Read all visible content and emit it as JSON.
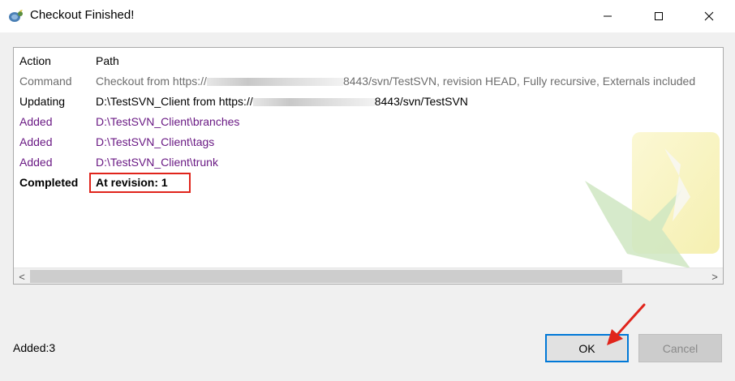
{
  "window": {
    "title": "Checkout Finished!",
    "controls": {
      "minimize": "minimize",
      "maximize": "maximize",
      "close": "close"
    }
  },
  "table": {
    "headers": {
      "action": "Action",
      "path": "Path"
    },
    "rows": [
      {
        "action": "Command",
        "path_prefix": "Checkout from https://",
        "path_suffix": "8443/svn/TestSVN, revision HEAD, Fully recursive, Externals included"
      },
      {
        "action": "Updating",
        "path_prefix": "D:\\TestSVN_Client from https://",
        "path_suffix": "8443/svn/TestSVN"
      },
      {
        "action": "Added",
        "path": "D:\\TestSVN_Client\\branches"
      },
      {
        "action": "Added",
        "path": "D:\\TestSVN_Client\\tags"
      },
      {
        "action": "Added",
        "path": "D:\\TestSVN_Client\\trunk"
      },
      {
        "action": "Completed",
        "path": "At revision: 1"
      }
    ]
  },
  "scrollbar": {
    "left": "<",
    "right": ">"
  },
  "status": "Added:3",
  "buttons": {
    "ok": "OK",
    "cancel": "Cancel"
  },
  "colors": {
    "command_text": "#6d6d6d",
    "added_text": "#6a1a84",
    "annotation_red": "#e0241b",
    "focus_blue": "#0078d7"
  },
  "icons": {
    "app": "tortoise-svn-icon",
    "watermark": "green-checkmark-icon",
    "annotation": "red-arrow-icon"
  }
}
